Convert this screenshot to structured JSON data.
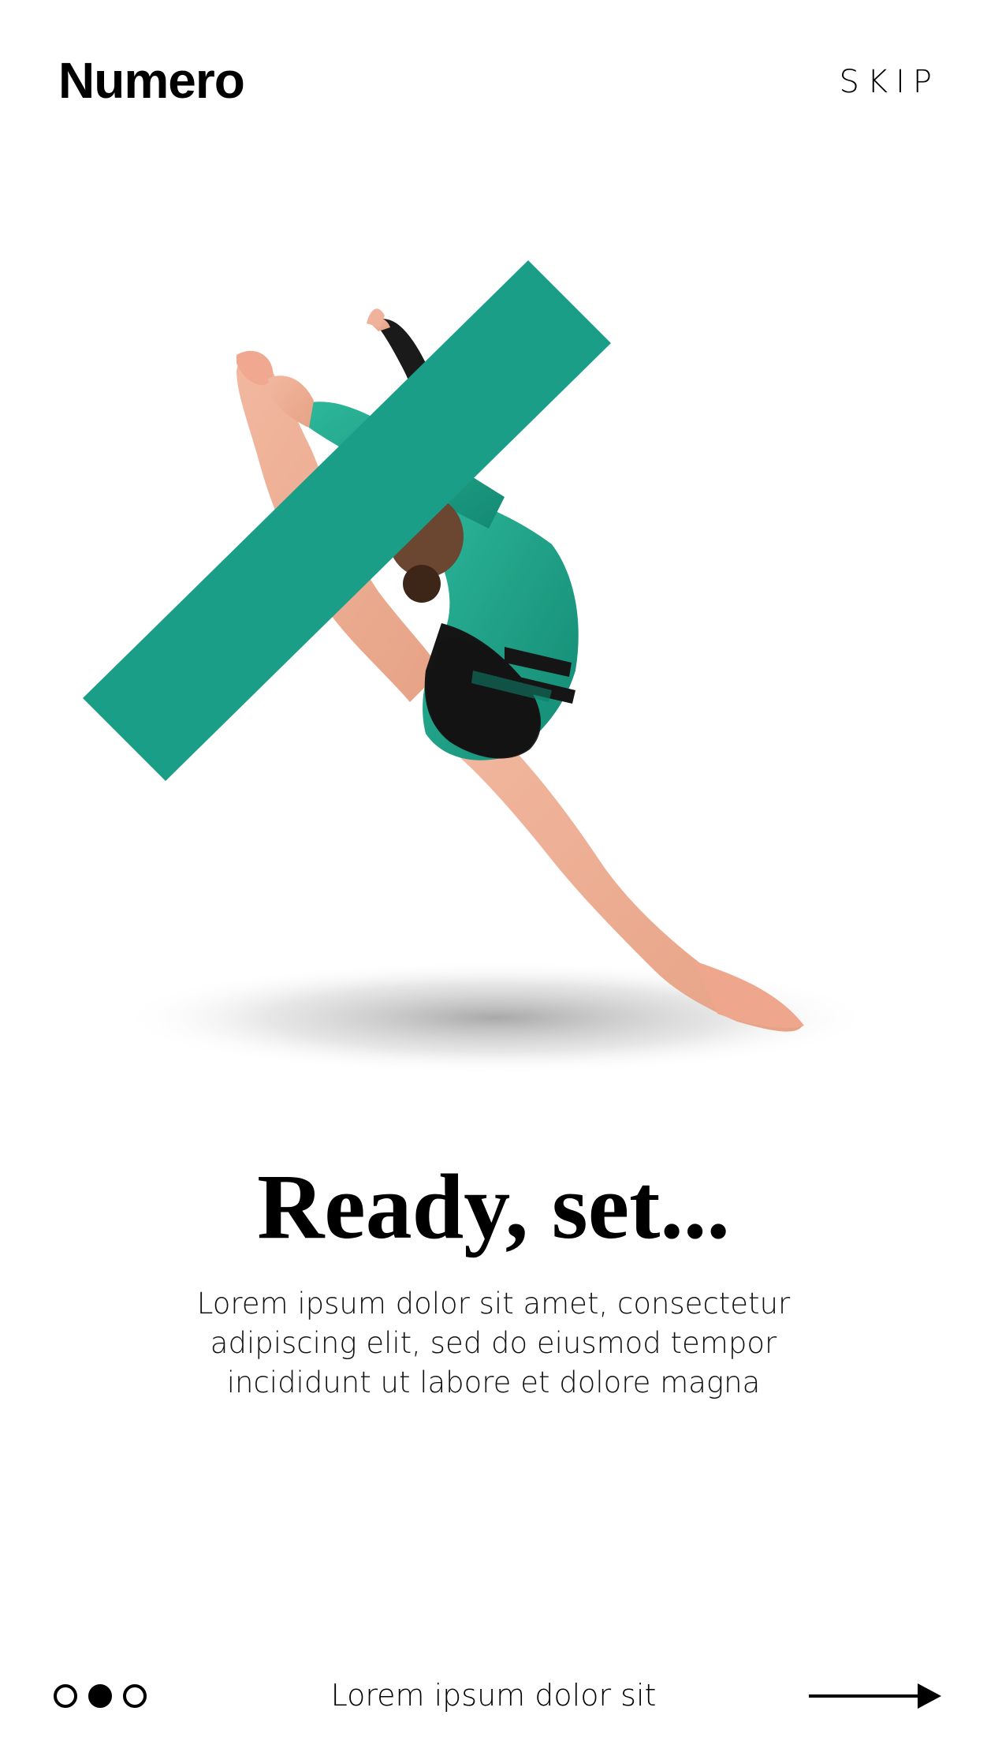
{
  "app": {
    "brand": "Numero",
    "skip_label": "SKIP",
    "accent_color": "#1a9e87"
  },
  "hero": {
    "image_alt": "gymnast-leaping-over-green-bar"
  },
  "content": {
    "title": "Ready, set...",
    "description": "Lorem ipsum dolor sit amet, consectetur adipiscing elit, sed do eiusmod tempor incididunt ut labore et dolore magna"
  },
  "footer": {
    "pager": {
      "count": 3,
      "active_index": 1
    },
    "caption": "Lorem ipsum dolor sit",
    "next_icon": "arrow-right-icon"
  }
}
